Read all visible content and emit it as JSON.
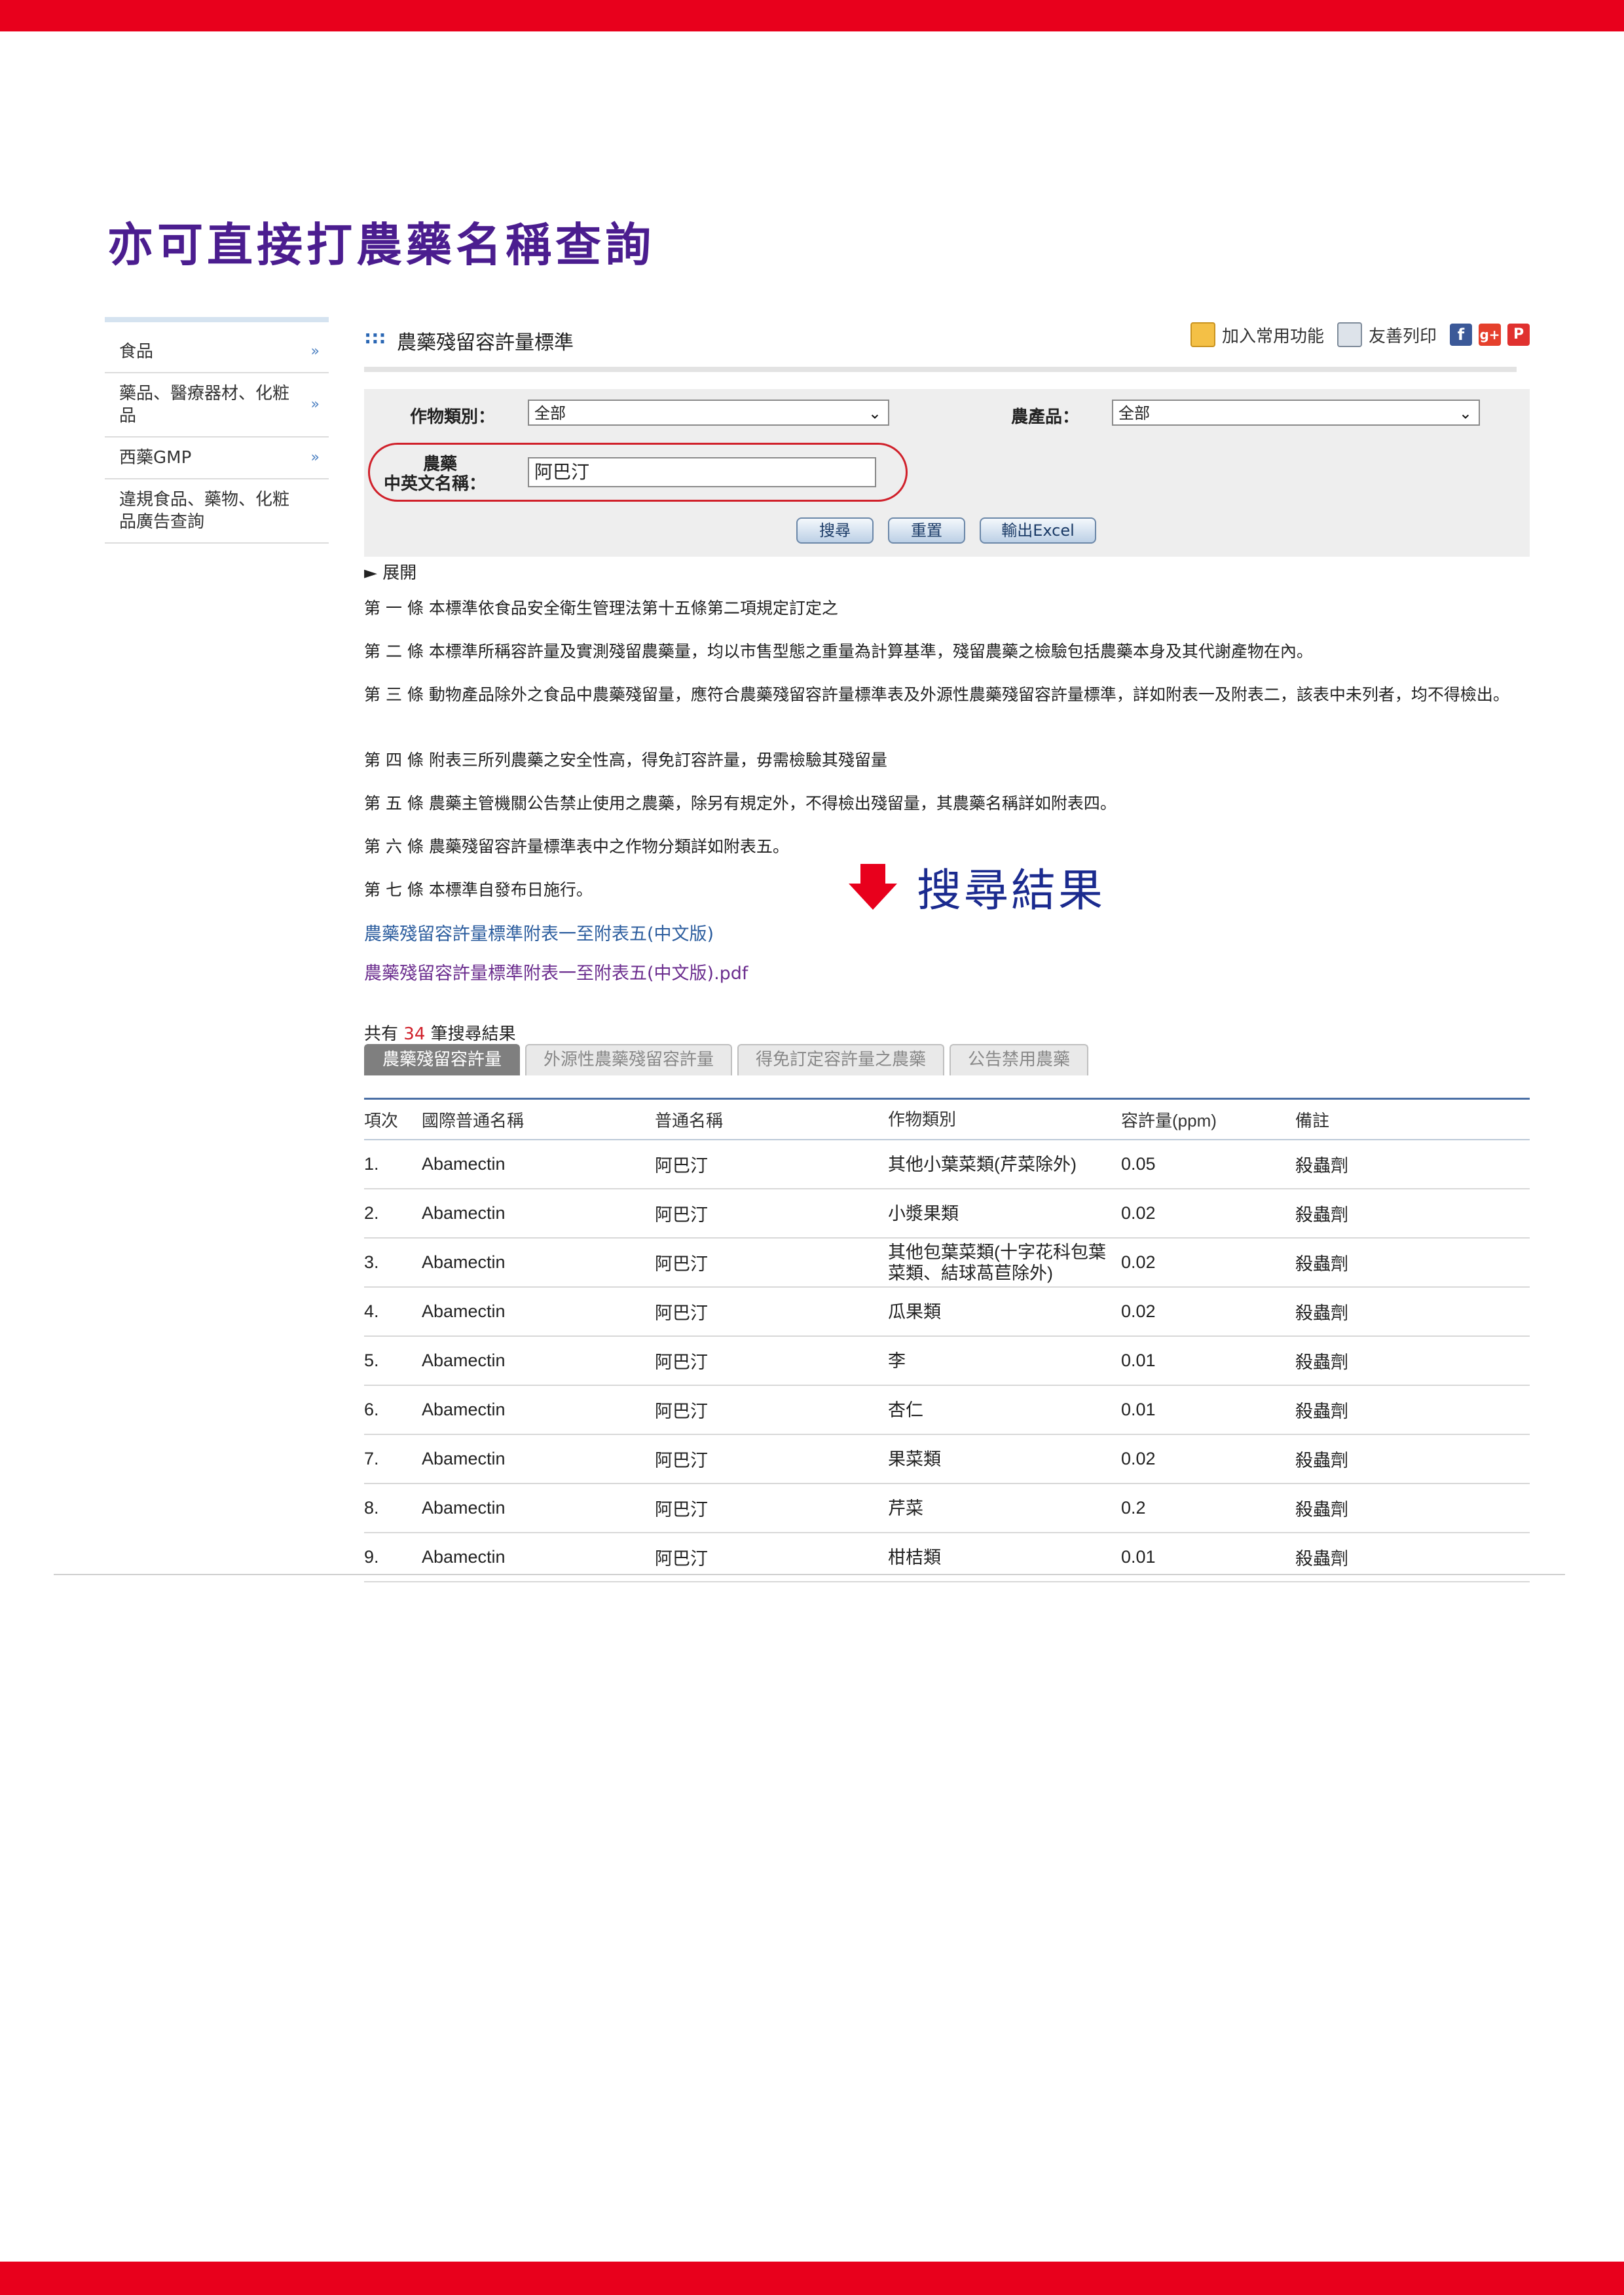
{
  "hero_title": "亦可直接打農藥名稱查詢",
  "sidebar": {
    "items": [
      {
        "label": "食品"
      },
      {
        "label": "藥品、醫療器材、化粧品"
      },
      {
        "label": "西藥GMP"
      },
      {
        "label": "違規食品、藥物、化粧品廣告查詢"
      }
    ]
  },
  "header": {
    "dots": ":::",
    "title": "農藥殘留容許量標準",
    "add_favorite": "加入常用功能",
    "print": "友善列印",
    "social": [
      "f",
      "g+",
      "P"
    ]
  },
  "filters": {
    "crop_type_label": "作物類別：",
    "crop_type_value": "全部",
    "product_label": "農產品：",
    "product_value": "全部",
    "pesticide_label_1": "農藥",
    "pesticide_label_2": "中英文名稱：",
    "pesticide_value": "阿巴汀",
    "buttons": {
      "search": "搜尋",
      "reset": "重置",
      "export": "輸出Excel"
    }
  },
  "expand_label": "► 展開",
  "articles": [
    "第 一 條 本標準依食品安全衛生管理法第十五條第二項規定訂定之",
    "第 二 條 本標準所稱容許量及實測殘留農藥量，均以市售型態之重量為計算基準，殘留農藥之檢驗包括農藥本身及其代謝產物在內。",
    "第 三 條 動物產品除外之食品中農藥殘留量，應符合農藥殘留容許量標準表及外源性農藥殘留容許量標準，詳如附表一及附表二，該表中未列者，均不得檢出。",
    "第 四 條 附表三所列農藥之安全性高，得免訂容許量，毋需檢驗其殘留量",
    "第 五 條 農藥主管機關公告禁止使用之農藥，除另有規定外，不得檢出殘留量，其農藥名稱詳如附表四。",
    "第 六 條 農藥殘留容許量標準表中之作物分類詳如附表五。",
    "第 七 條 本標準自發布日施行。"
  ],
  "links": {
    "annex_html": "農藥殘留容許量標準附表一至附表五(中文版)",
    "annex_pdf": "農藥殘留容許量標準附表一至附表五(中文版).pdf"
  },
  "annotation": "搜尋結果",
  "results": {
    "prefix": "共有",
    "count": "34",
    "suffix": "筆搜尋結果"
  },
  "tabs": [
    {
      "label": "農藥殘留容許量"
    },
    {
      "label": "外源性農藥殘留容許量"
    },
    {
      "label": "得免訂定容許量之農藥"
    },
    {
      "label": "公告禁用農藥"
    }
  ],
  "table": {
    "headers": [
      "項次",
      "國際普通名稱",
      "普通名稱",
      "作物類別",
      "容許量(ppm)",
      "備註"
    ],
    "rows": [
      [
        "1.",
        "Abamectin",
        "阿巴汀",
        "其他小葉菜類(芹菜除外)",
        "0.05",
        "殺蟲劑"
      ],
      [
        "2.",
        "Abamectin",
        "阿巴汀",
        "小漿果類",
        "0.02",
        "殺蟲劑"
      ],
      [
        "3.",
        "Abamectin",
        "阿巴汀",
        "其他包葉菜類(十字花科包葉菜類、結球萵苣除外)",
        "0.02",
        "殺蟲劑"
      ],
      [
        "4.",
        "Abamectin",
        "阿巴汀",
        "瓜果類",
        "0.02",
        "殺蟲劑"
      ],
      [
        "5.",
        "Abamectin",
        "阿巴汀",
        "李",
        "0.01",
        "殺蟲劑"
      ],
      [
        "6.",
        "Abamectin",
        "阿巴汀",
        "杏仁",
        "0.01",
        "殺蟲劑"
      ],
      [
        "7.",
        "Abamectin",
        "阿巴汀",
        "果菜類",
        "0.02",
        "殺蟲劑"
      ],
      [
        "8.",
        "Abamectin",
        "阿巴汀",
        "芹菜",
        "0.2",
        "殺蟲劑"
      ],
      [
        "9.",
        "Abamectin",
        "阿巴汀",
        "柑桔類",
        "0.01",
        "殺蟲劑"
      ]
    ]
  },
  "colors": {
    "band": "#e8001c",
    "hero": "#4b1d8f",
    "annotation": "#1b2b8f",
    "oval": "#d0202a"
  }
}
